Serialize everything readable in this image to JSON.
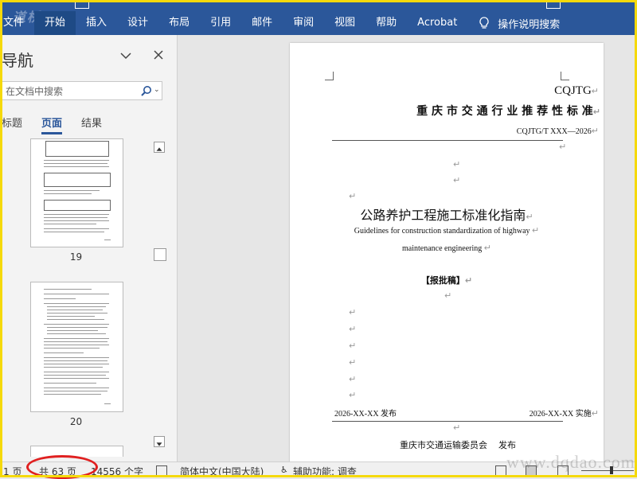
{
  "ribbon": {
    "watermark": "道桥网",
    "tabs": [
      "文件",
      "开始",
      "插入",
      "设计",
      "布局",
      "引用",
      "邮件",
      "审阅",
      "视图",
      "帮助",
      "Acrobat"
    ],
    "active_tab": "开始",
    "tell_me": "操作说明搜索",
    "colors": {
      "ribbon_bg": "#2b579a",
      "active_tab_bg": "#1e4a85"
    }
  },
  "nav": {
    "title": "导航",
    "search_placeholder": "在文档中搜索",
    "tabs": [
      "标题",
      "页面",
      "结果"
    ],
    "active_tab": "页面",
    "pages": [
      {
        "number": "19"
      },
      {
        "number": "20"
      }
    ]
  },
  "document": {
    "code": "CQJTG",
    "std_title": "重 庆 市 交 通 行 业 推 荐 性 标 准",
    "std_number": "CQJTG/T XXX—2026",
    "title_cn": "公路养护工程施工标准化指南",
    "title_en_line1": "Guidelines for construction standardization of highway",
    "title_en_line2": "maintenance engineering",
    "draft_tag": "【报批稿】",
    "release_date": "2026-XX-XX 发布",
    "effective_date": "2026-XX-XX 实施",
    "publisher": "重庆市交通运输委员会",
    "publish_word": "发布",
    "para_mark": "↵"
  },
  "status": {
    "page_info_prefix": "1 页",
    "page_info": "共 63 页",
    "word_count": "14556 个字",
    "language": "简体中文(中国大陆)",
    "accessibility": "辅助功能: 调查",
    "watermark_site": "www.dqdao.com"
  }
}
